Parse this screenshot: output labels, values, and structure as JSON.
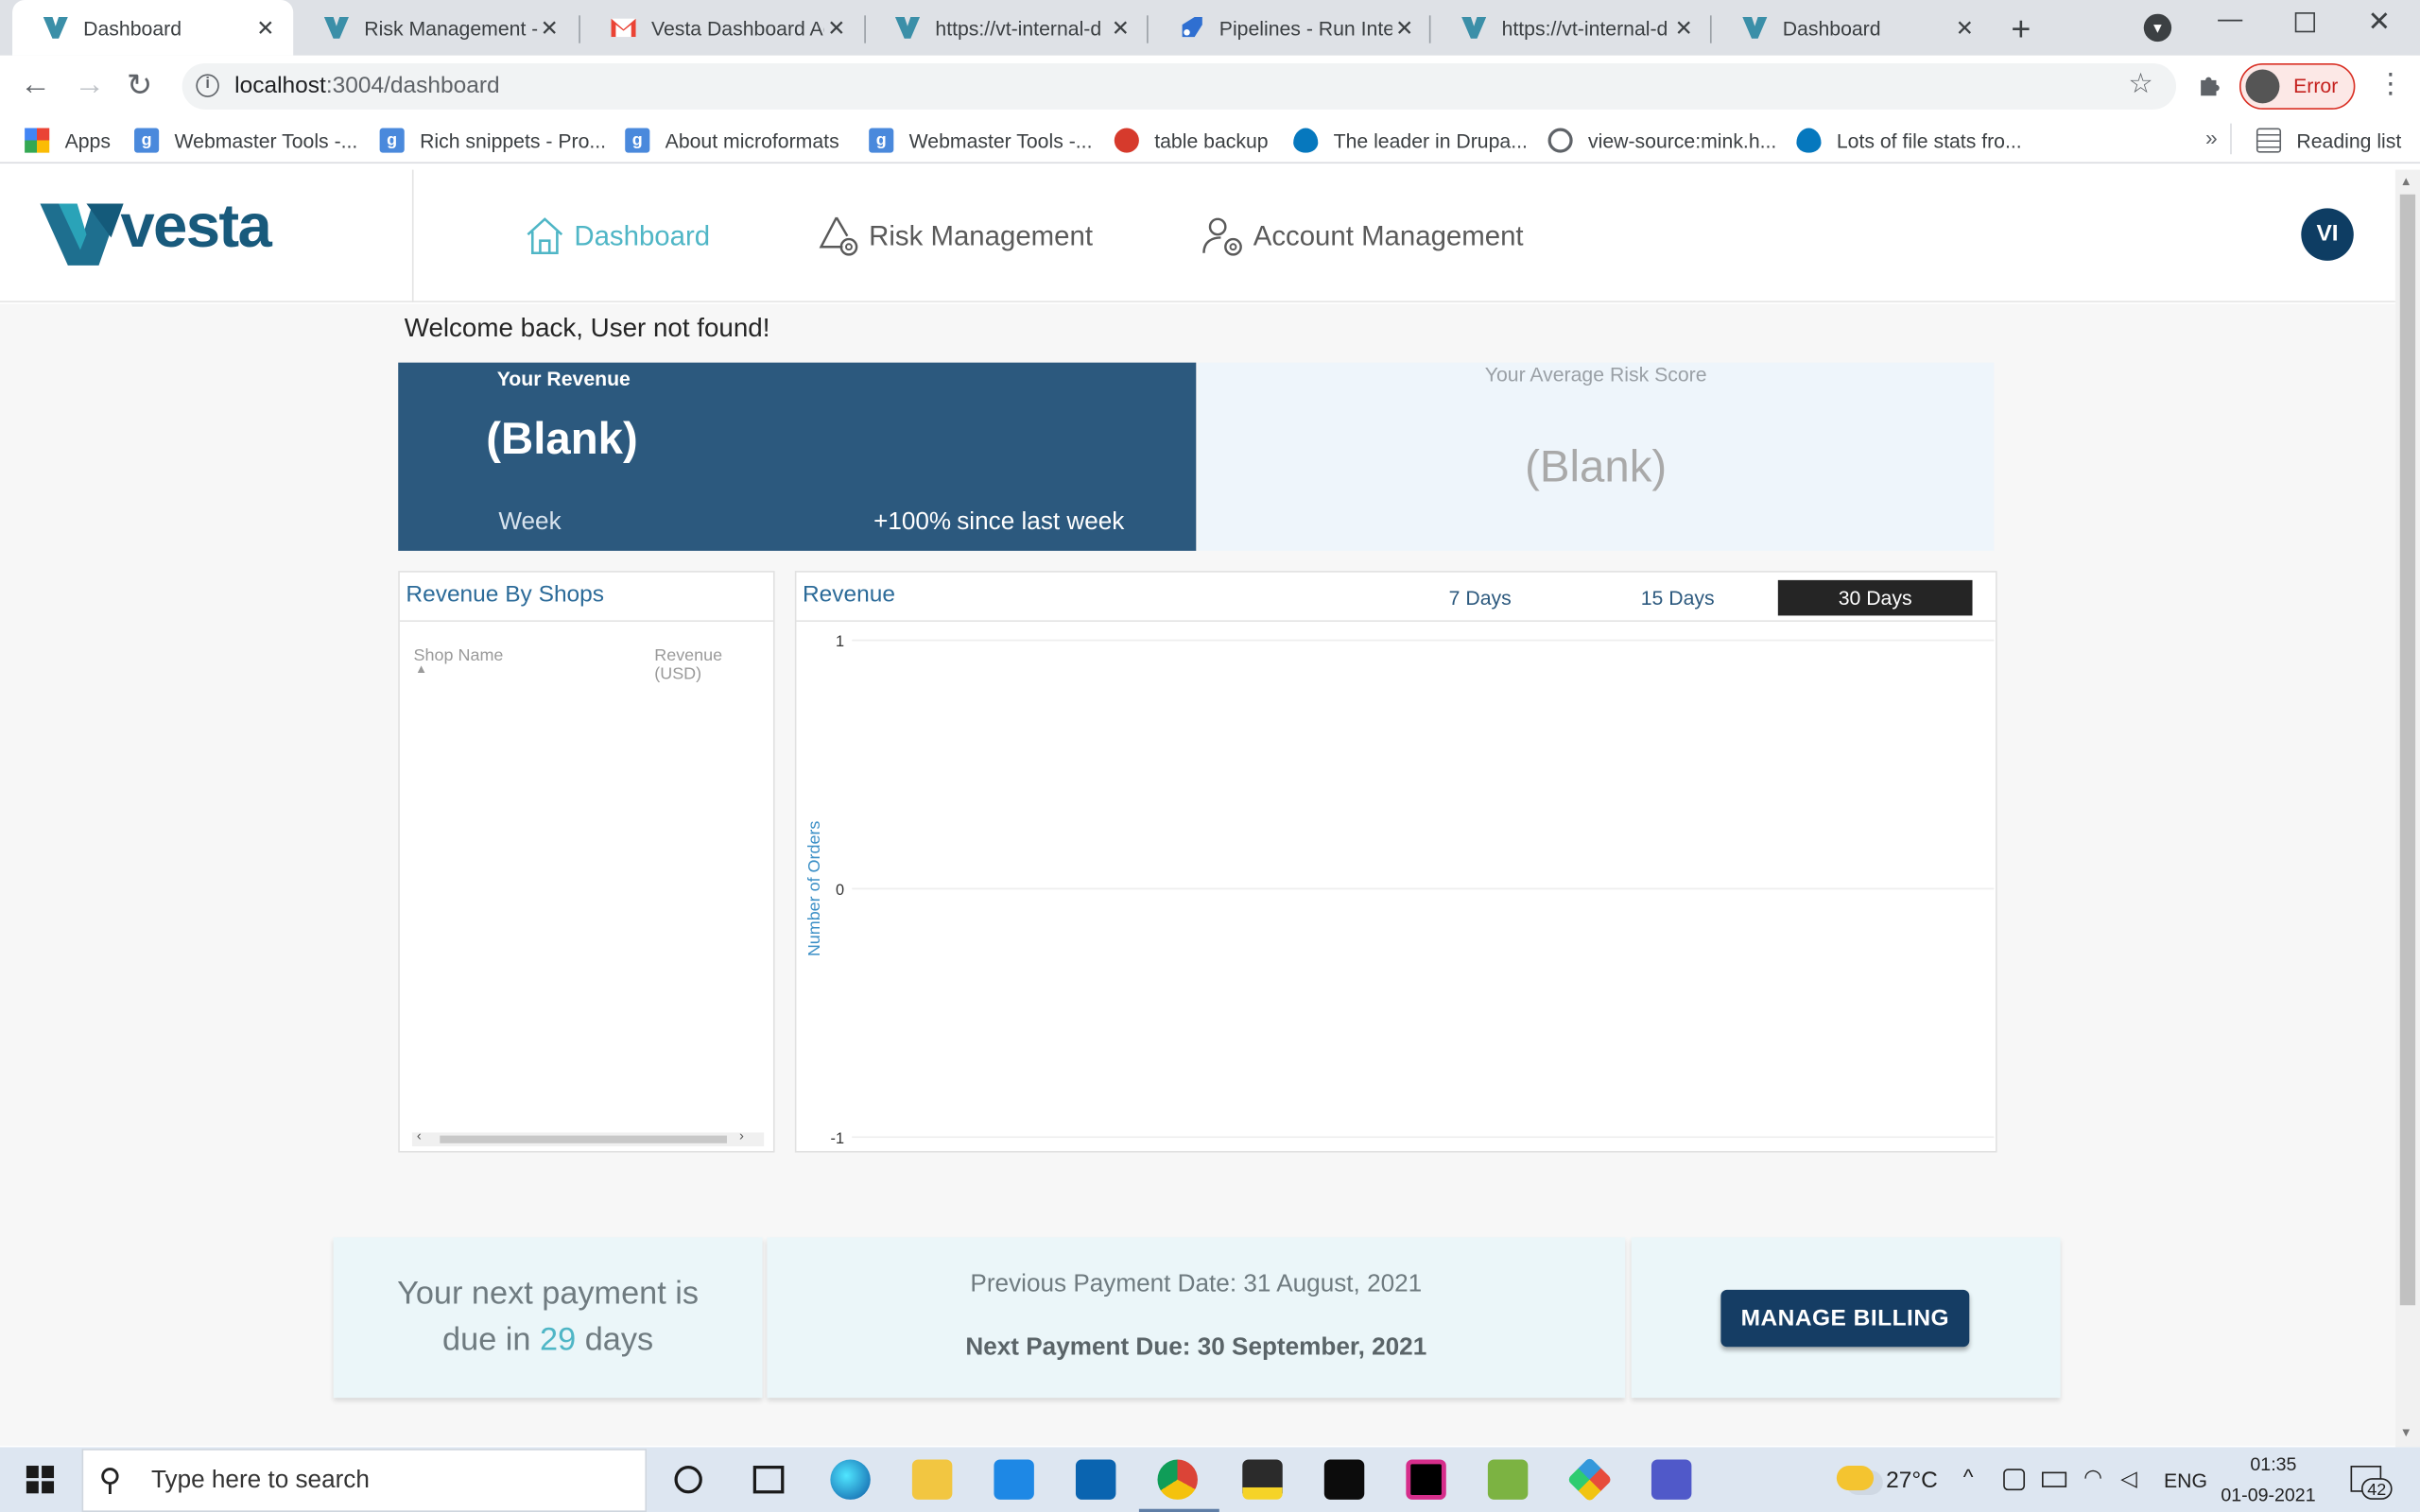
{
  "browser": {
    "tabs": [
      {
        "title": "Dashboard",
        "active": true
      },
      {
        "title": "Risk Management -"
      },
      {
        "title": "Vesta Dashboard Ac"
      },
      {
        "title": "https://vt-internal-d"
      },
      {
        "title": "Pipelines - Run Inter"
      },
      {
        "title": "https://vt-internal-d"
      },
      {
        "title": "Dashboard"
      }
    ],
    "url_host": "localhost",
    "url_path": ":3004/dashboard",
    "profile_status": "Error",
    "bookmarks": [
      "Apps",
      "Webmaster Tools -...",
      "Rich snippets - Pro...",
      "About microformats",
      "Webmaster Tools -...",
      "table backup",
      "The leader in Drupa...",
      "view-source:mink.h...",
      "Lots of file stats fro..."
    ],
    "reading_list": "Reading list"
  },
  "app": {
    "brand": "vesta",
    "nav": [
      {
        "label": "Dashboard",
        "icon": "home-icon",
        "active": true
      },
      {
        "label": "Risk Management",
        "icon": "risk-gear-icon"
      },
      {
        "label": "Account Management",
        "icon": "user-gear-icon"
      }
    ],
    "avatar_initials": "VI",
    "welcome": "Welcome back, User not found!",
    "revenue_card": {
      "title": "Your Revenue",
      "value": "(Blank)",
      "period": "Week",
      "change": "+100%",
      "change_suffix": "since last week"
    },
    "risk_card": {
      "title": "Your Average Risk Score",
      "value": "(Blank)"
    },
    "shops_table": {
      "title": "Revenue By Shops",
      "columns": [
        "Shop Name",
        "Revenue (USD)"
      ],
      "rows": []
    },
    "revenue_chart": {
      "title": "Revenue",
      "ranges": [
        "7 Days",
        "15 Days",
        "30 Days"
      ],
      "selected_range": "30 Days"
    },
    "payment": {
      "due_prefix": "Your next payment is",
      "due_mid": "due in",
      "due_days": "29",
      "due_suffix": "days",
      "previous": "Previous Payment Date: 31 August, 2021",
      "next": "Next Payment Due: 30 September, 2021",
      "manage_label": "MANAGE BILLING"
    },
    "colors": {
      "accent": "#4fb6c6",
      "navy": "#2c597e",
      "button": "#153d64"
    }
  },
  "chart_data": {
    "type": "line",
    "title": "Revenue",
    "xlabel": "",
    "ylabel": "Number of Orders",
    "yticks": [
      "1",
      "0",
      "-1"
    ],
    "ylim": [
      -1,
      1
    ],
    "series": []
  },
  "taskbar": {
    "search_placeholder": "Type here to search",
    "temperature": "27°C",
    "language": "ENG",
    "time": "01:35",
    "date": "01-09-2021",
    "notifications": "42"
  }
}
